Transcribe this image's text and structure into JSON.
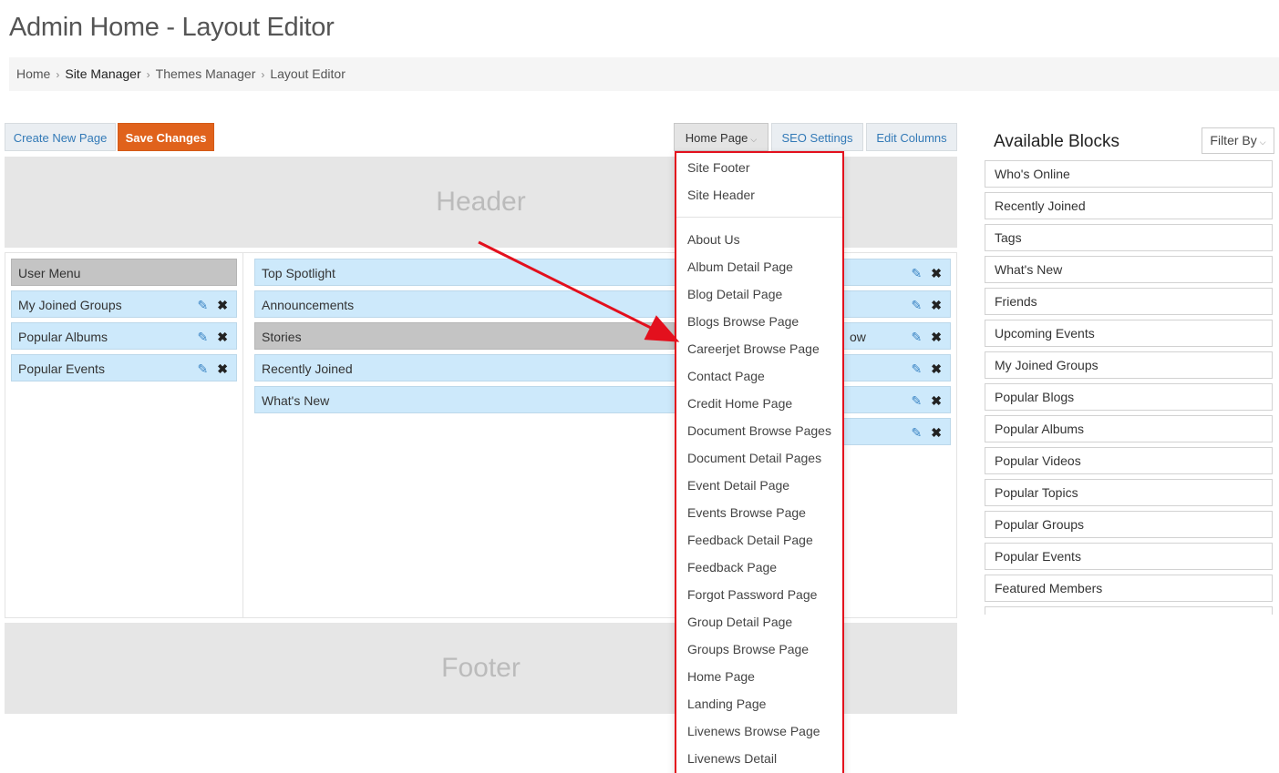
{
  "page": {
    "title": "Admin Home - Layout Editor"
  },
  "breadcrumb": {
    "items": [
      "Home",
      "Site Manager",
      "Themes Manager",
      "Layout Editor"
    ]
  },
  "toolbar": {
    "create_label": "Create New Page",
    "save_label": "Save Changes",
    "page_select_label": "Home Page",
    "seo_label": "SEO Settings",
    "columns_label": "Edit Columns"
  },
  "regions": {
    "header": "Header",
    "footer": "Footer"
  },
  "left_column": {
    "heading": "User Menu",
    "blocks": [
      "My Joined Groups",
      "Popular Albums",
      "Popular Events"
    ]
  },
  "middle_column": {
    "blocks": [
      "Top Spotlight",
      "Announcements",
      "Stories",
      "Recently Joined",
      "What's New"
    ]
  },
  "right_column": {
    "partial_text": "ow"
  },
  "dropdown": {
    "group1": [
      "Site Footer",
      "Site Header"
    ],
    "group2": [
      "About Us",
      "Album Detail Page",
      "Blog Detail Page",
      "Blogs Browse Page",
      "Careerjet Browse Page",
      "Contact Page",
      "Credit Home Page",
      "Document Browse Pages",
      "Document Detail Pages",
      "Event Detail Page",
      "Events Browse Page",
      "Feedback Detail Page",
      "Feedback Page",
      "Forgot Password Page",
      "Group Detail Page",
      "Groups Browse Page",
      "Home Page",
      "Landing Page",
      "Livenews Browse Page",
      "Livenews Detail"
    ]
  },
  "available": {
    "title": "Available Blocks",
    "filter_label": "Filter By",
    "items": [
      "Who's Online",
      "Recently Joined",
      "Tags",
      "What's New",
      "Friends",
      "Upcoming Events",
      "My Joined Groups",
      "Popular Blogs",
      "Popular Albums",
      "Popular Videos",
      "Popular Topics",
      "Popular Groups",
      "Popular Events",
      "Featured Members"
    ]
  },
  "icons": {
    "edit": "pencil-icon",
    "remove": "close-icon",
    "caret": "chevron-down-icon"
  },
  "colors": {
    "accent": "#e0621c",
    "highlight": "#e3101d",
    "block_bg": "#cde9fb"
  }
}
